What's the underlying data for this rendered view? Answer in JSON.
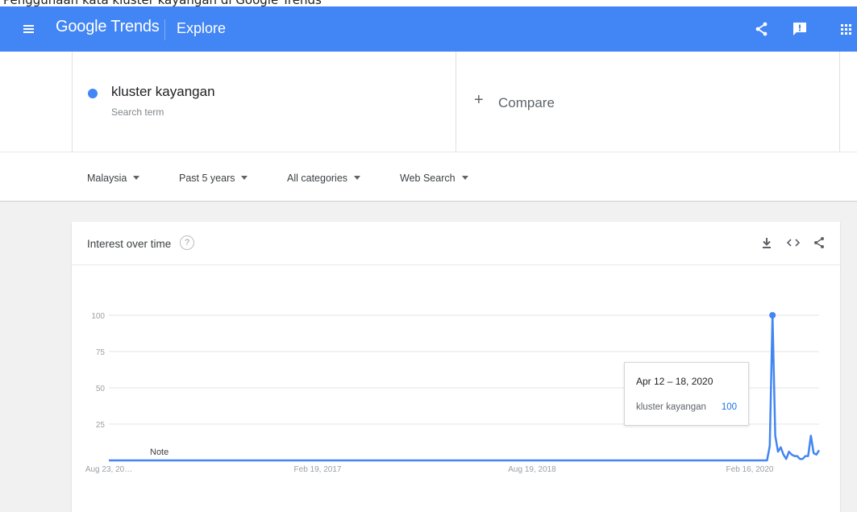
{
  "caption": "Penggunaan kata kluster kayangan di Google Trends",
  "header": {
    "logo_google": "Google",
    "logo_trends": "Trends",
    "section": "Explore"
  },
  "search": {
    "term": "kluster kayangan",
    "term_type": "Search term",
    "compare_plus": "+",
    "compare_label": "Compare"
  },
  "filters": [
    {
      "label": "Malaysia"
    },
    {
      "label": "Past 5 years"
    },
    {
      "label": "All categories"
    },
    {
      "label": "Web Search"
    }
  ],
  "interest_card": {
    "title": "Interest over time",
    "help": "?"
  },
  "tooltip": {
    "date": "Apr 12 – 18, 2020",
    "term": "kluster kayangan",
    "value": "100"
  },
  "colors": {
    "brand_blue": "#4285f4",
    "series": "#4285f4",
    "tooltip_value": "#1a73e8"
  },
  "chart_data": {
    "type": "line",
    "title": "Interest over time",
    "xlabel": "",
    "ylabel": "",
    "ylim": [
      0,
      100
    ],
    "y_ticks": [
      "100",
      "75",
      "50",
      "25"
    ],
    "x_tick_labels": [
      "Aug 23, 20…",
      "Feb 19, 2017",
      "Aug 19, 2018",
      "Feb 16, 2020"
    ],
    "grid": true,
    "annotation": "Note",
    "series": [
      {
        "name": "kluster kayangan",
        "x": [
          "2015-08-23",
          "2016-01-03",
          "2017-02-19",
          "2018-01-07",
          "2018-08-19",
          "2019-06-02",
          "2020-01-12",
          "2020-03-29",
          "2020-04-05",
          "2020-04-12",
          "2020-04-19",
          "2020-04-26",
          "2020-05-03",
          "2020-05-10",
          "2020-05-17",
          "2020-05-24",
          "2020-05-31",
          "2020-06-07",
          "2020-06-14",
          "2020-06-21",
          "2020-06-28",
          "2020-07-05",
          "2020-07-12",
          "2020-07-19",
          "2020-07-26",
          "2020-08-02",
          "2020-08-09"
        ],
        "values": [
          0,
          0,
          0,
          0,
          0,
          0,
          0,
          0,
          10,
          100,
          17,
          6,
          9,
          4,
          1,
          6,
          4,
          3,
          3,
          1,
          1,
          3,
          3,
          17,
          5,
          4,
          7
        ]
      }
    ]
  }
}
